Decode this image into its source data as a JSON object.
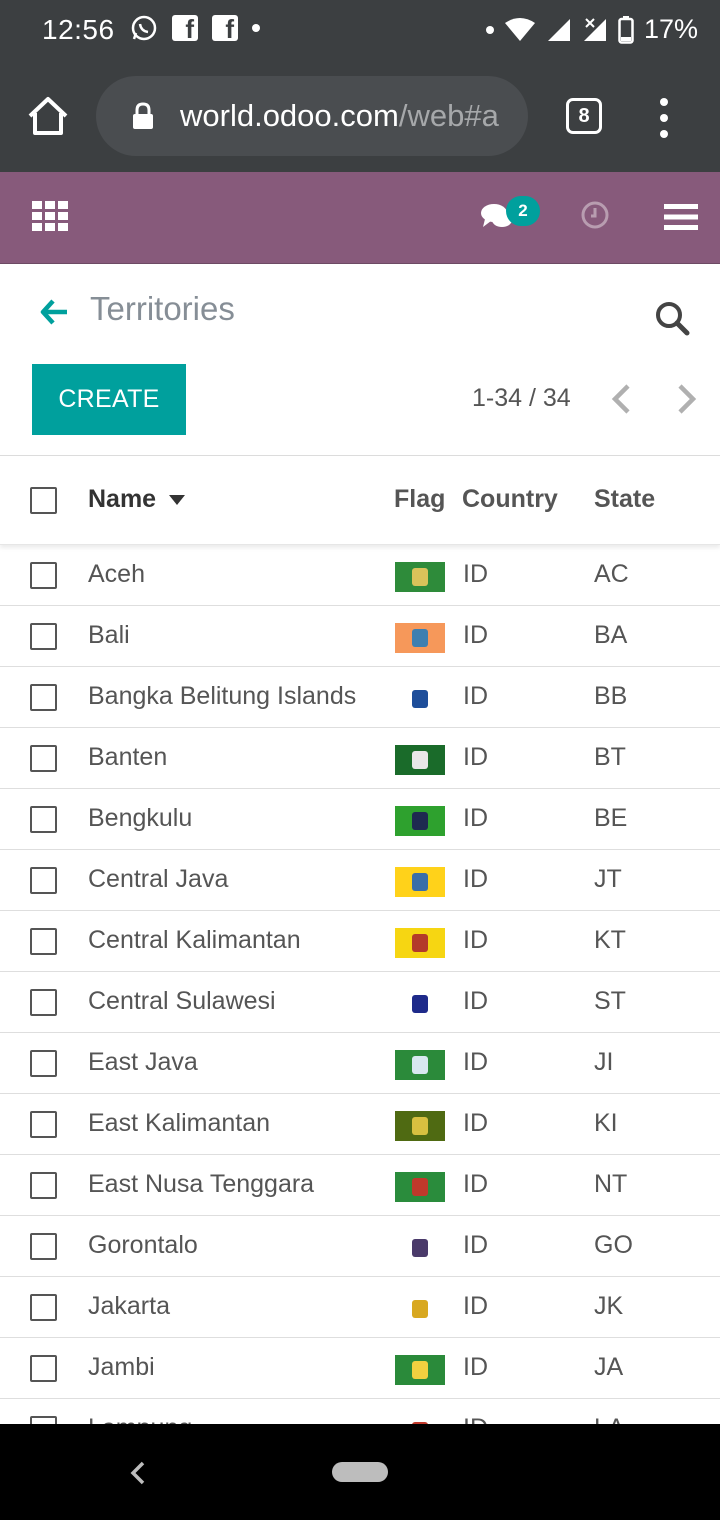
{
  "status_bar": {
    "time": "12:56",
    "battery": "17%"
  },
  "browser": {
    "url_main": "world.odoo.com",
    "url_rest": "/web#a",
    "tab_count": "8"
  },
  "navbar": {
    "messages_badge": "2"
  },
  "control_panel": {
    "title": "Territories",
    "create_label": "CREATE",
    "pager": "1-34 / 34"
  },
  "list": {
    "columns": {
      "name": "Name",
      "flag": "Flag",
      "country": "Country",
      "state": "State"
    },
    "rows": [
      {
        "name": "Aceh",
        "country": "ID",
        "state": "AC",
        "flag_bg": "#2e8b3a",
        "flag_emblem": "#d9c35a"
      },
      {
        "name": "Bali",
        "country": "ID",
        "state": "BA",
        "flag_bg": "#f6985a",
        "flag_emblem": "#3d7fb0"
      },
      {
        "name": "Bangka Belitung Islands",
        "country": "ID",
        "state": "BB",
        "flag_bg": "#ffffff",
        "flag_emblem": "#1e4e9a"
      },
      {
        "name": "Banten",
        "country": "ID",
        "state": "BT",
        "flag_bg": "#1a6b2a",
        "flag_emblem": "#e8e8e8"
      },
      {
        "name": "Bengkulu",
        "country": "ID",
        "state": "BE",
        "flag_bg": "#2ea12e",
        "flag_emblem": "#1e2a50"
      },
      {
        "name": "Central Java",
        "country": "ID",
        "state": "JT",
        "flag_bg": "#ffd21a",
        "flag_emblem": "#3a6ea8"
      },
      {
        "name": "Central Kalimantan",
        "country": "ID",
        "state": "KT",
        "flag_bg": "#f6d612",
        "flag_emblem": "#b33a2a"
      },
      {
        "name": "Central Sulawesi",
        "country": "ID",
        "state": "ST",
        "flag_bg": "#ffffff",
        "flag_emblem": "#1e2a8a"
      },
      {
        "name": "East Java",
        "country": "ID",
        "state": "JI",
        "flag_bg": "#2b8a3a",
        "flag_emblem": "#d8e8f0"
      },
      {
        "name": "East Kalimantan",
        "country": "ID",
        "state": "KI",
        "flag_bg": "#4f6a12",
        "flag_emblem": "#d8c040"
      },
      {
        "name": "East Nusa Tenggara",
        "country": "ID",
        "state": "NT",
        "flag_bg": "#2a8c3c",
        "flag_emblem": "#c0392b"
      },
      {
        "name": "Gorontalo",
        "country": "ID",
        "state": "GO",
        "flag_bg": "#ffffff",
        "flag_emblem": "#4a3a6a"
      },
      {
        "name": "Jakarta",
        "country": "ID",
        "state": "JK",
        "flag_bg": "#ffffff",
        "flag_emblem": "#d8a820"
      },
      {
        "name": "Jambi",
        "country": "ID",
        "state": "JA",
        "flag_bg": "#2a8a3a",
        "flag_emblem": "#f0d040"
      },
      {
        "name": "Lampung",
        "country": "ID",
        "state": "LA",
        "flag_bg": "#ffffff",
        "flag_emblem": "#c0392b"
      }
    ]
  },
  "colors": {
    "odoo_purple": "#875a7b",
    "teal": "#00a09d",
    "status_bg": "#3c3f41"
  }
}
